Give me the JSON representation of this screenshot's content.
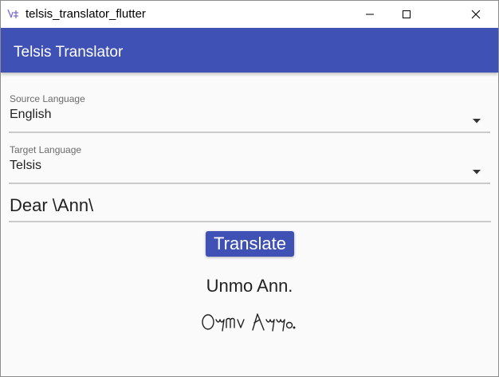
{
  "window": {
    "title": "telsis_translator_flutter",
    "icon": "flutter-app-icon",
    "controls": [
      "minimize-icon",
      "maximize-icon",
      "close-icon"
    ]
  },
  "appbar": {
    "title": "Telsis Translator",
    "color": "#3f51b5"
  },
  "source_language": {
    "label": "Source Language",
    "value": "English",
    "icon": "dropdown-arrow-icon"
  },
  "target_language": {
    "label": "Target Language",
    "value": "Telsis",
    "icon": "dropdown-arrow-icon"
  },
  "input": {
    "value": "Dear \\Ann\\"
  },
  "translate_button": {
    "label": "Translate",
    "color": "#3f51b5"
  },
  "result": {
    "transliteration": "Unmo Ann.",
    "script_text": "Oymv Ayyo."
  }
}
